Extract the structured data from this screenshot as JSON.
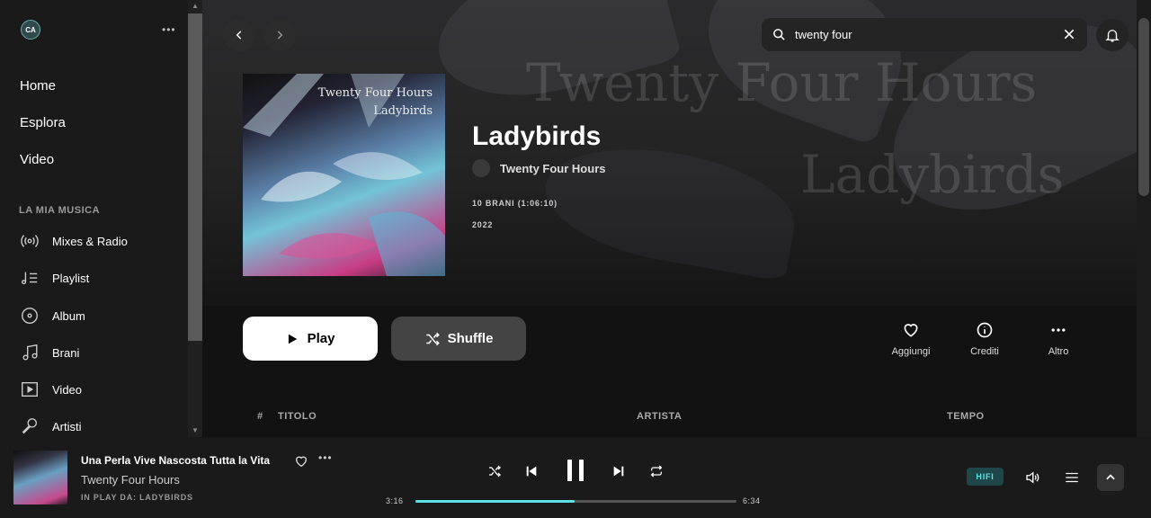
{
  "user": {
    "initials": "CA"
  },
  "sidebar": {
    "main_nav": [
      {
        "label": "Home"
      },
      {
        "label": "Esplora"
      },
      {
        "label": "Video"
      }
    ],
    "section_label": "LA MIA MUSICA",
    "library": [
      {
        "label": "Mixes & Radio",
        "icon": "radio-icon"
      },
      {
        "label": "Playlist",
        "icon": "playlist-icon"
      },
      {
        "label": "Album",
        "icon": "album-icon"
      },
      {
        "label": "Brani",
        "icon": "music-note-icon"
      },
      {
        "label": "Video",
        "icon": "video-icon"
      },
      {
        "label": "Artisti",
        "icon": "microphone-icon"
      }
    ]
  },
  "search": {
    "value": "twenty four"
  },
  "album": {
    "cover_text_line1": "Twenty Four Hours",
    "cover_text_line2": "Ladybirds",
    "title": "Ladybirds",
    "artist": "Twenty Four Hours",
    "tracks_info": "10 BRANI  (1:06:10)",
    "year": "2022",
    "ghost_line1": "Twenty Four Hours",
    "ghost_line2": "Ladybirds"
  },
  "buttons": {
    "play": "Play",
    "shuffle": "Shuffle",
    "add": "Aggiungi",
    "credits": "Crediti",
    "more": "Altro"
  },
  "table": {
    "col_num": "#",
    "col_title": "TITOLO",
    "col_artist": "ARTISTA",
    "col_time": "TEMPO"
  },
  "player": {
    "track_title": "Una Perla Vive Nascosta Tutta la Vita",
    "track_artist": "Twenty Four Hours",
    "playing_from": "IN PLAY DA: LADYBIRDS",
    "elapsed": "3:16",
    "duration": "6:34",
    "progress_fraction": 0.497,
    "quality_badge": "HIFI"
  },
  "colors": {
    "accent": "#5ce0e6",
    "sidebar_bg": "#1a1a1a",
    "main_bg": "#121212"
  }
}
